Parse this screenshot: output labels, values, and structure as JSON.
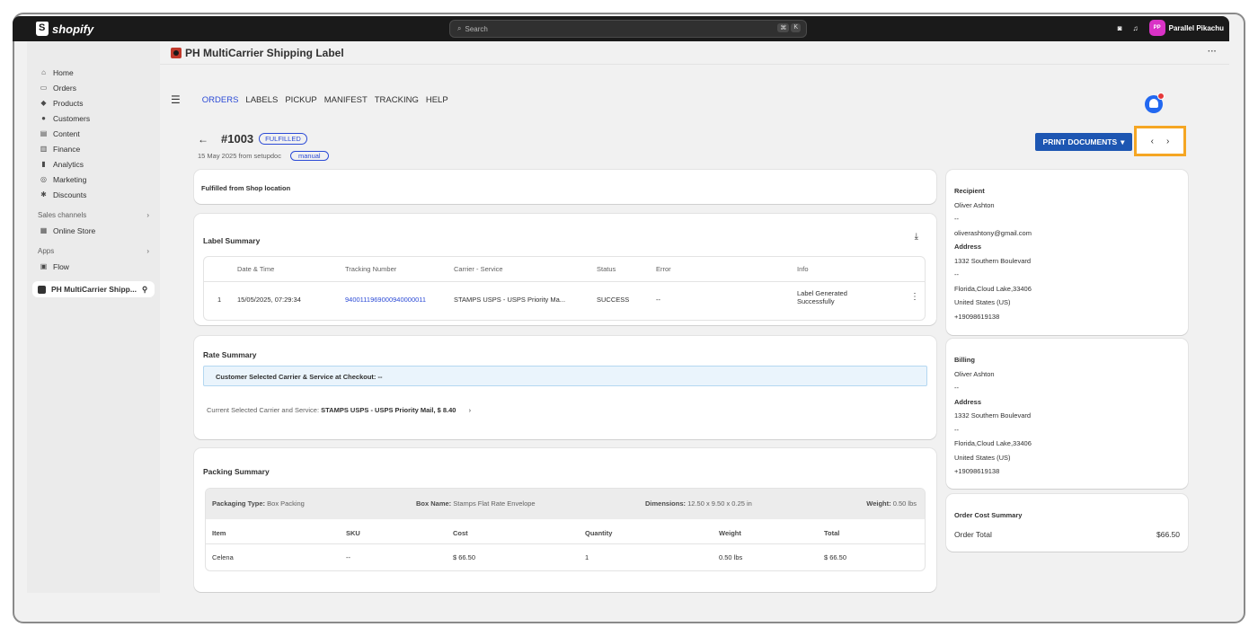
{
  "topbar": {
    "brand": "shopify",
    "search_placeholder": "Search",
    "kbd": [
      "⌘",
      "K"
    ],
    "user_initials": "PP",
    "user_name": "Parallel Pikachu"
  },
  "sidebar": {
    "items": [
      {
        "label": "Home",
        "icon": "home-icon"
      },
      {
        "label": "Orders",
        "icon": "orders-icon"
      },
      {
        "label": "Products",
        "icon": "tag-icon"
      },
      {
        "label": "Customers",
        "icon": "person-icon"
      },
      {
        "label": "Content",
        "icon": "content-icon"
      },
      {
        "label": "Finance",
        "icon": "bank-icon"
      },
      {
        "label": "Analytics",
        "icon": "bar-chart-icon"
      },
      {
        "label": "Marketing",
        "icon": "target-icon"
      },
      {
        "label": "Discounts",
        "icon": "discount-icon"
      }
    ],
    "sales_channels_label": "Sales channels",
    "online_store": "Online Store",
    "apps_label": "Apps",
    "flow": "Flow",
    "app_pinned": "PH MultiCarrier Shipp..."
  },
  "app": {
    "title": "PH MultiCarrier Shipping Label",
    "tabs": [
      "ORDERS",
      "LABELS",
      "PICKUP",
      "MANIFEST",
      "TRACKING",
      "HELP"
    ]
  },
  "order": {
    "number": "#1003",
    "status": "FULFILLED",
    "date_source": "15 May 2025 from setupdoc",
    "tag": "manual",
    "print_button": "PRINT DOCUMENTS",
    "fulfilled_from": "Fulfilled from Shop location"
  },
  "label_summary": {
    "title": "Label Summary",
    "headers": [
      "Date & Time",
      "Tracking Number",
      "Carrier - Service",
      "Status",
      "Error",
      "Info"
    ],
    "row": {
      "index": "1",
      "date_time": "15/05/2025, 07:29:34",
      "tracking": "9400111969000940000011",
      "carrier": "STAMPS USPS - USPS Priority Ma...",
      "status": "SUCCESS",
      "error": "--",
      "info_line1": "Label Generated",
      "info_line2": "Successfully"
    }
  },
  "rate_summary": {
    "title": "Rate Summary",
    "banner": "Customer Selected Carrier & Service at Checkout: --",
    "current_label": "Current Selected Carrier and Service:",
    "current_value": "STAMPS USPS - USPS Priority Mail, $ 8.40"
  },
  "packing_summary": {
    "title": "Packing Summary",
    "packaging_type_label": "Packaging Type:",
    "packaging_type": "Box Packing",
    "box_name_label": "Box Name:",
    "box_name": "Stamps Flat Rate Envelope",
    "dimensions_label": "Dimensions:",
    "dimensions": "12.50 x 9.50 x 0.25 in",
    "weight_label": "Weight:",
    "weight": "0.50 lbs",
    "headers": [
      "Item",
      "SKU",
      "Cost",
      "Quantity",
      "Weight",
      "Total"
    ],
    "row": [
      "Celena",
      "--",
      "$ 66.50",
      "1",
      "0.50 lbs",
      "$ 66.50"
    ]
  },
  "recipient": {
    "title": "Recipient",
    "name": "Oliver Ashton",
    "dash1": "--",
    "email": "oliverashtony@gmail.com",
    "address_label": "Address",
    "street": "1332 Southern Boulevard",
    "dash2": "--",
    "city": "Florida,Cloud Lake,33406",
    "country": "United States (US)",
    "phone": "+19098619138"
  },
  "billing": {
    "title": "Billing",
    "name": "Oliver Ashton",
    "dash1": "--",
    "address_label": "Address",
    "street": "1332 Southern Boulevard",
    "dash2": "--",
    "city": "Florida,Cloud Lake,33406",
    "country": "United States (US)",
    "phone": "+19098619138"
  },
  "order_cost": {
    "title": "Order Cost Summary",
    "total_label": "Order Total",
    "total_value": "$66.50"
  },
  "colors": {
    "accent_blue": "#2c4bd6",
    "button_blue": "#1d56b2",
    "highlight": "#f5a623"
  }
}
